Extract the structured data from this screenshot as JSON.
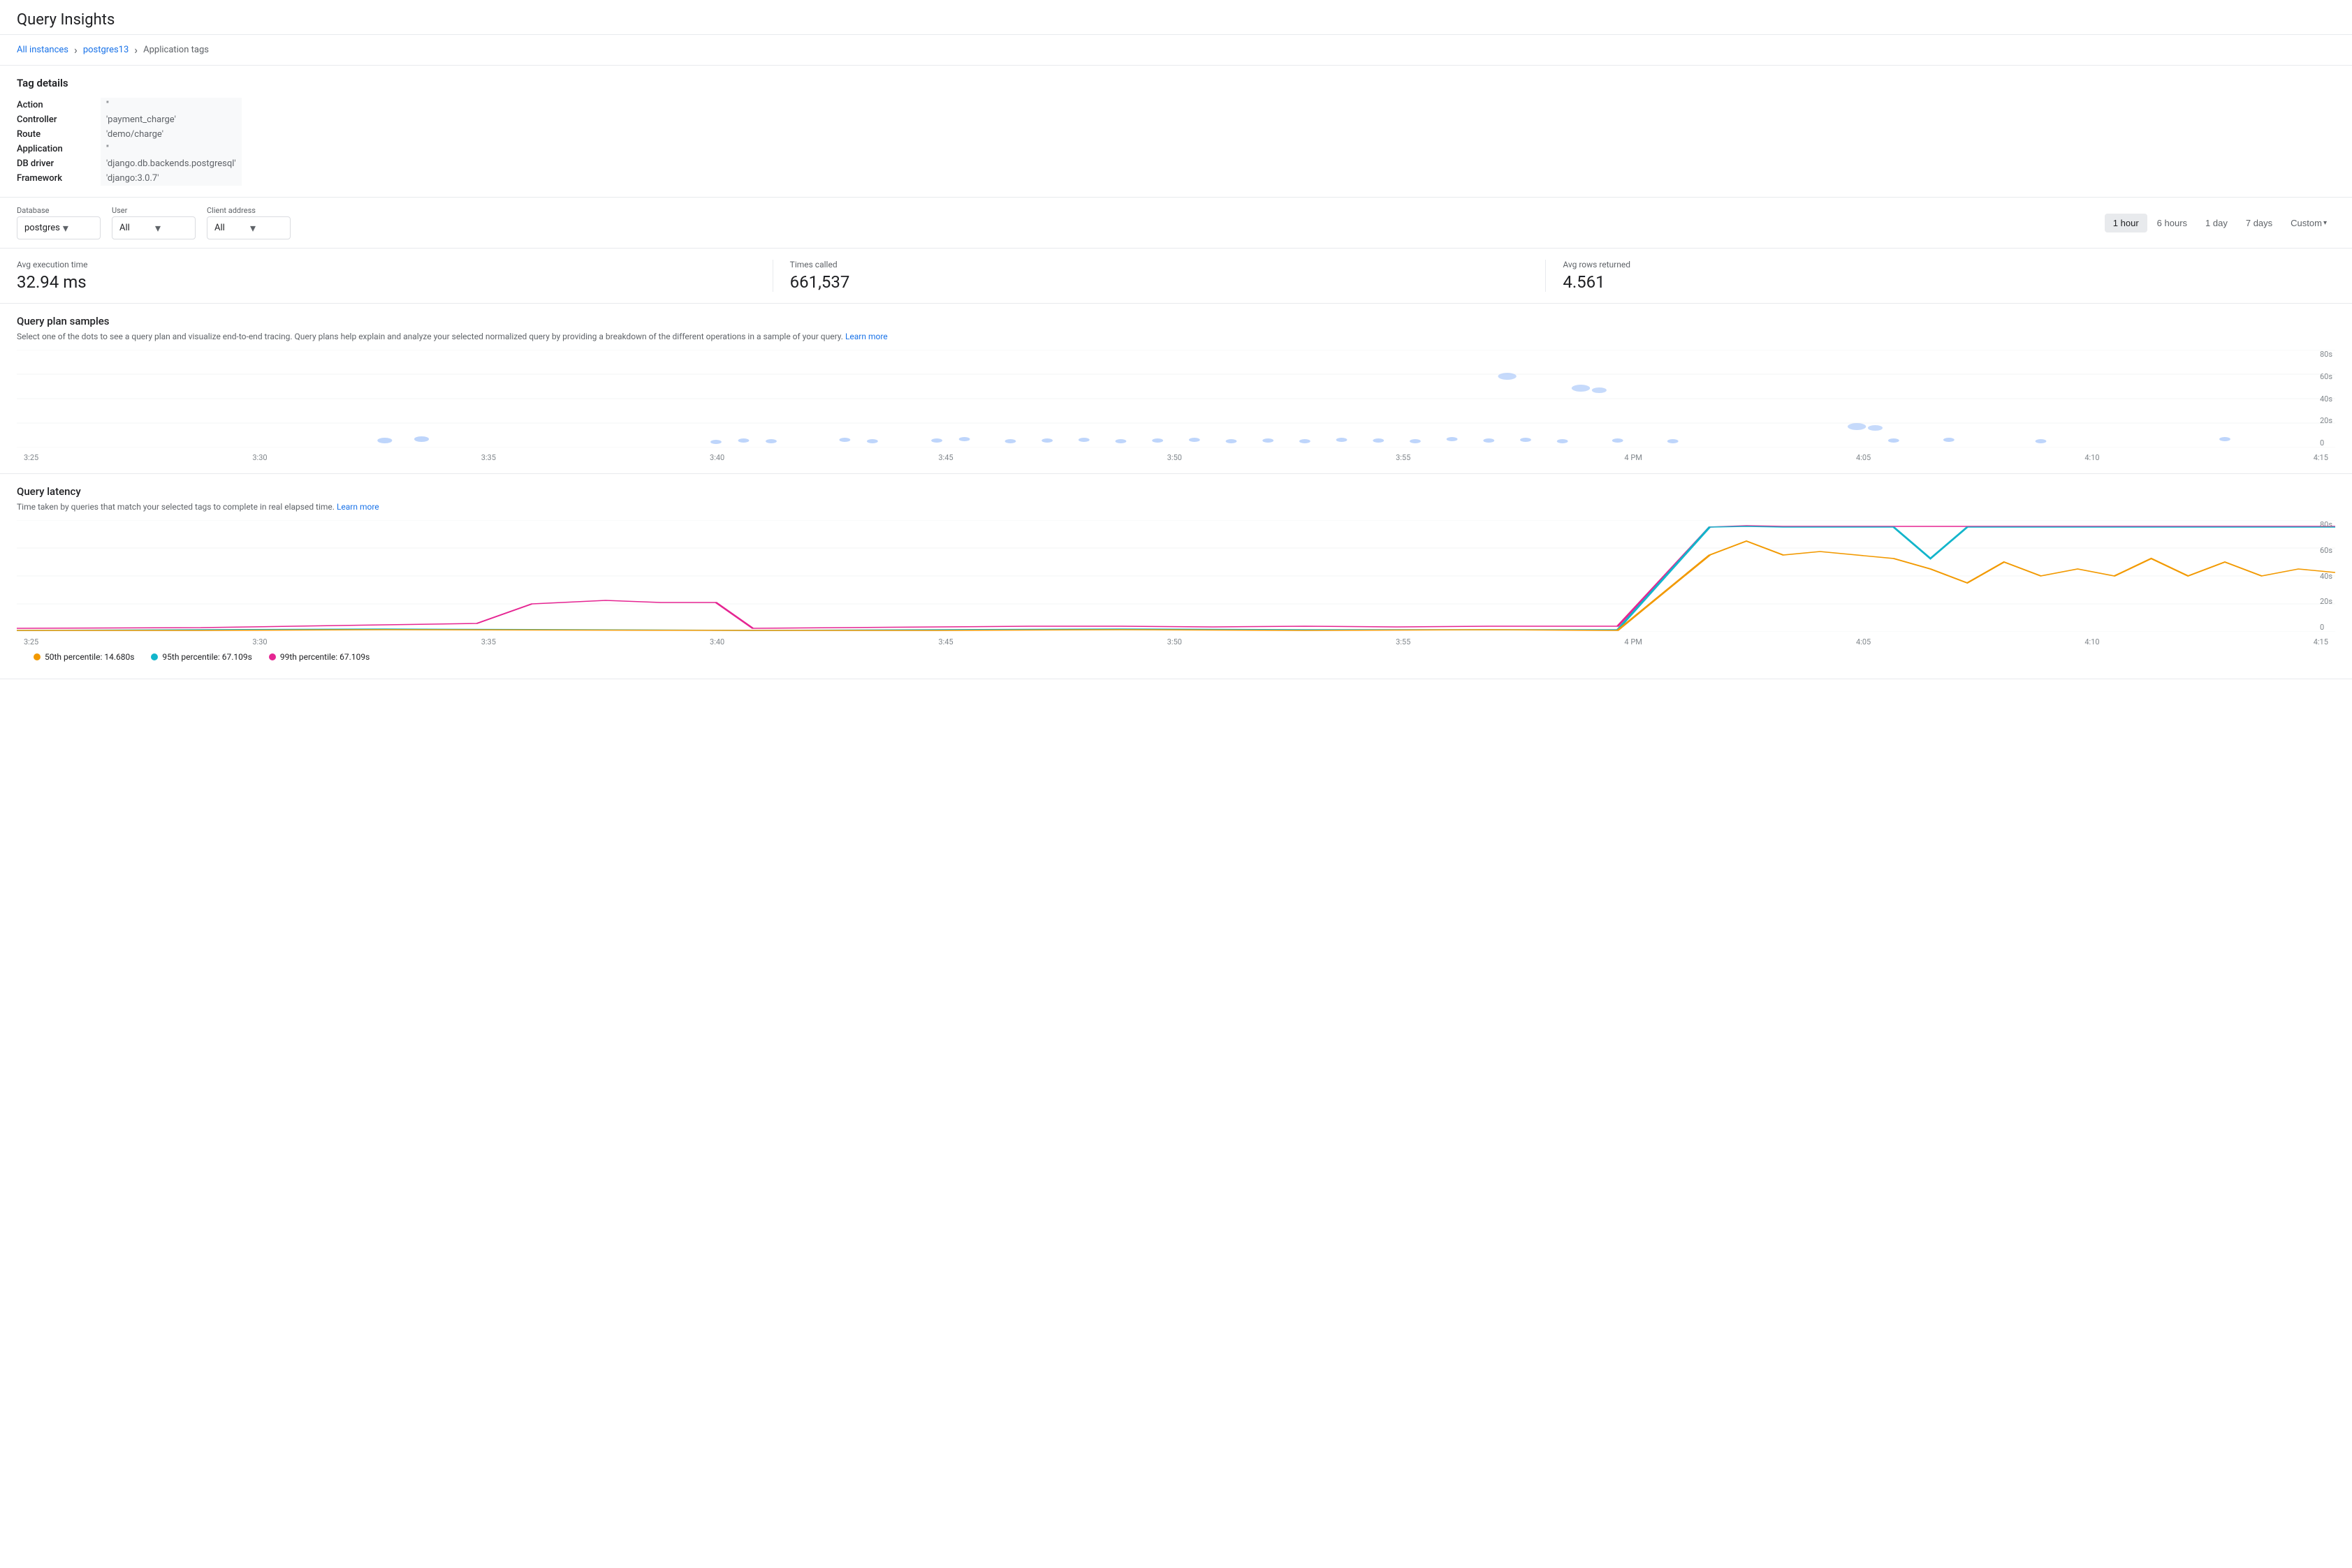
{
  "page": {
    "title": "Query Insights"
  },
  "breadcrumb": {
    "items": [
      "All instances",
      "postgres13",
      "Application tags"
    ],
    "links": [
      true,
      true,
      false
    ]
  },
  "tag_details": {
    "heading": "Tag details",
    "rows": [
      {
        "label": "Action",
        "value": "''"
      },
      {
        "label": "Controller",
        "value": "'payment_charge'"
      },
      {
        "label": "Route",
        "value": "'demo/charge'"
      },
      {
        "label": "Application",
        "value": "''"
      },
      {
        "label": "DB driver",
        "value": "'django.db.backends.postgresql'"
      },
      {
        "label": "Framework",
        "value": "'django:3.0.7'"
      }
    ]
  },
  "filters": {
    "database": {
      "label": "Database",
      "value": "postgres",
      "options": [
        "postgres"
      ]
    },
    "user": {
      "label": "User",
      "value": "All",
      "options": [
        "All"
      ]
    },
    "client_address": {
      "label": "Client address",
      "value": "All",
      "options": [
        "All"
      ]
    }
  },
  "time_buttons": [
    {
      "label": "1 hour",
      "active": true
    },
    {
      "label": "6 hours",
      "active": false
    },
    {
      "label": "1 day",
      "active": false
    },
    {
      "label": "7 days",
      "active": false
    },
    {
      "label": "Custom",
      "active": false
    }
  ],
  "metrics": [
    {
      "label": "Avg execution time",
      "value": "32.94 ms"
    },
    {
      "label": "Times called",
      "value": "661,537"
    },
    {
      "label": "Avg rows returned",
      "value": "4.561"
    }
  ],
  "query_plan": {
    "heading": "Query plan samples",
    "description": "Select one of the dots to see a query plan and visualize end-to-end tracing. Query plans help explain and analyze your selected normalized query by providing a breakdown of the different operations in a sample of your query.",
    "learn_more": "Learn more",
    "x_labels": [
      "3:25",
      "3:30",
      "3:35",
      "3:40",
      "3:45",
      "3:50",
      "3:55",
      "4 PM",
      "4:05",
      "4:10",
      "4:15"
    ],
    "y_labels": [
      "80s",
      "60s",
      "40s",
      "20s",
      "0"
    ]
  },
  "query_latency": {
    "heading": "Query latency",
    "description": "Time taken by queries that match your selected tags to complete in real elapsed time.",
    "learn_more": "Learn more",
    "x_labels": [
      "3:25",
      "3:30",
      "3:35",
      "3:40",
      "3:45",
      "3:50",
      "3:55",
      "4 PM",
      "4:05",
      "4:10",
      "4:15"
    ],
    "y_labels": [
      "80s",
      "60s",
      "40s",
      "20s",
      "0"
    ],
    "legend": [
      {
        "label": "50th percentile: 14.680s",
        "color": "#f29900"
      },
      {
        "label": "95th percentile: 67.109s",
        "color": "#12b5cb"
      },
      {
        "label": "99th percentile: 67.109s",
        "color": "#e52592"
      }
    ]
  },
  "colors": {
    "primary_blue": "#1a73e8",
    "border": "#e8eaed",
    "text_secondary": "#5f6368",
    "active_bg": "#e8eaed",
    "dot_color": "#9aa0a6",
    "line_50th": "#f29900",
    "line_95th": "#12b5cb",
    "line_99th": "#e52592"
  }
}
